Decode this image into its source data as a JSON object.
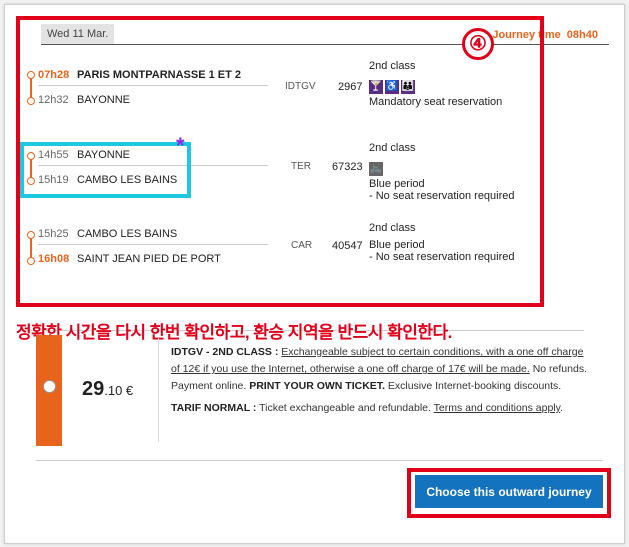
{
  "date": "Wed 11 Mar.",
  "journey_time": {
    "label": "Journey time",
    "value": "08h40"
  },
  "step_badge": "④",
  "segments": [
    {
      "dep_time": "07h28",
      "dep_station": "PARIS MONTPARNASSE 1 ET 2",
      "arr_time": "12h32",
      "arr_station": "BAYONNE",
      "train_type": "IDTGV",
      "train_number": "2967",
      "class": "2nd class",
      "icons": [
        "bar-icon",
        "wheelchair-icon",
        "family-icon"
      ],
      "notes": [
        "Mandatory seat reservation"
      ]
    },
    {
      "dep_time": "14h55",
      "dep_station": "BAYONNE",
      "arr_time": "15h19",
      "arr_station": "CAMBO LES BAINS",
      "train_type": "TER",
      "train_number": "67323",
      "class": "2nd class",
      "icons": [
        "bicycle-icon"
      ],
      "notes": [
        "Blue period",
        "- No seat reservation required"
      ]
    },
    {
      "dep_time": "15h25",
      "dep_station": "CAMBO LES BAINS",
      "arr_time": "16h08",
      "arr_station": "SAINT JEAN PIED DE PORT",
      "train_type": "CAR",
      "train_number": "40547",
      "class": "2nd class",
      "icons": [],
      "notes": [
        "Blue period",
        "- No seat reservation required"
      ]
    }
  ],
  "star": "*",
  "korean_note": "정확한 시간을 다시 한번 확인하고, 환승 지역을 반드시 확인한다.",
  "fare": {
    "price_int": "29",
    "price_dec": ".10 €",
    "idtgv_label": "IDTGV - 2ND CLASS :",
    "idtgv_conditions": "Exchangeable subject to certain conditions, with a one off charge of 12€ if you use the Internet, otherwise a one off charge of 17€ will be made.",
    "idtgv_rest": "No refunds. Payment online.",
    "print": "PRINT YOUR OWN TICKET.",
    "exclusive": "Exclusive Internet-booking discounts.",
    "normal_label": "TARIF NORMAL :",
    "normal_text": "Ticket exchangeable and refundable.",
    "terms": "Terms and conditions apply",
    "terms_end": "."
  },
  "choose_button": "Choose this outward journey",
  "colors": {
    "accent": "#e8641c",
    "annotation_red": "#e0001a",
    "annotation_cyan": "#1ec8e0",
    "button_blue": "#1473be",
    "icon_purple": "#5a2d82"
  }
}
